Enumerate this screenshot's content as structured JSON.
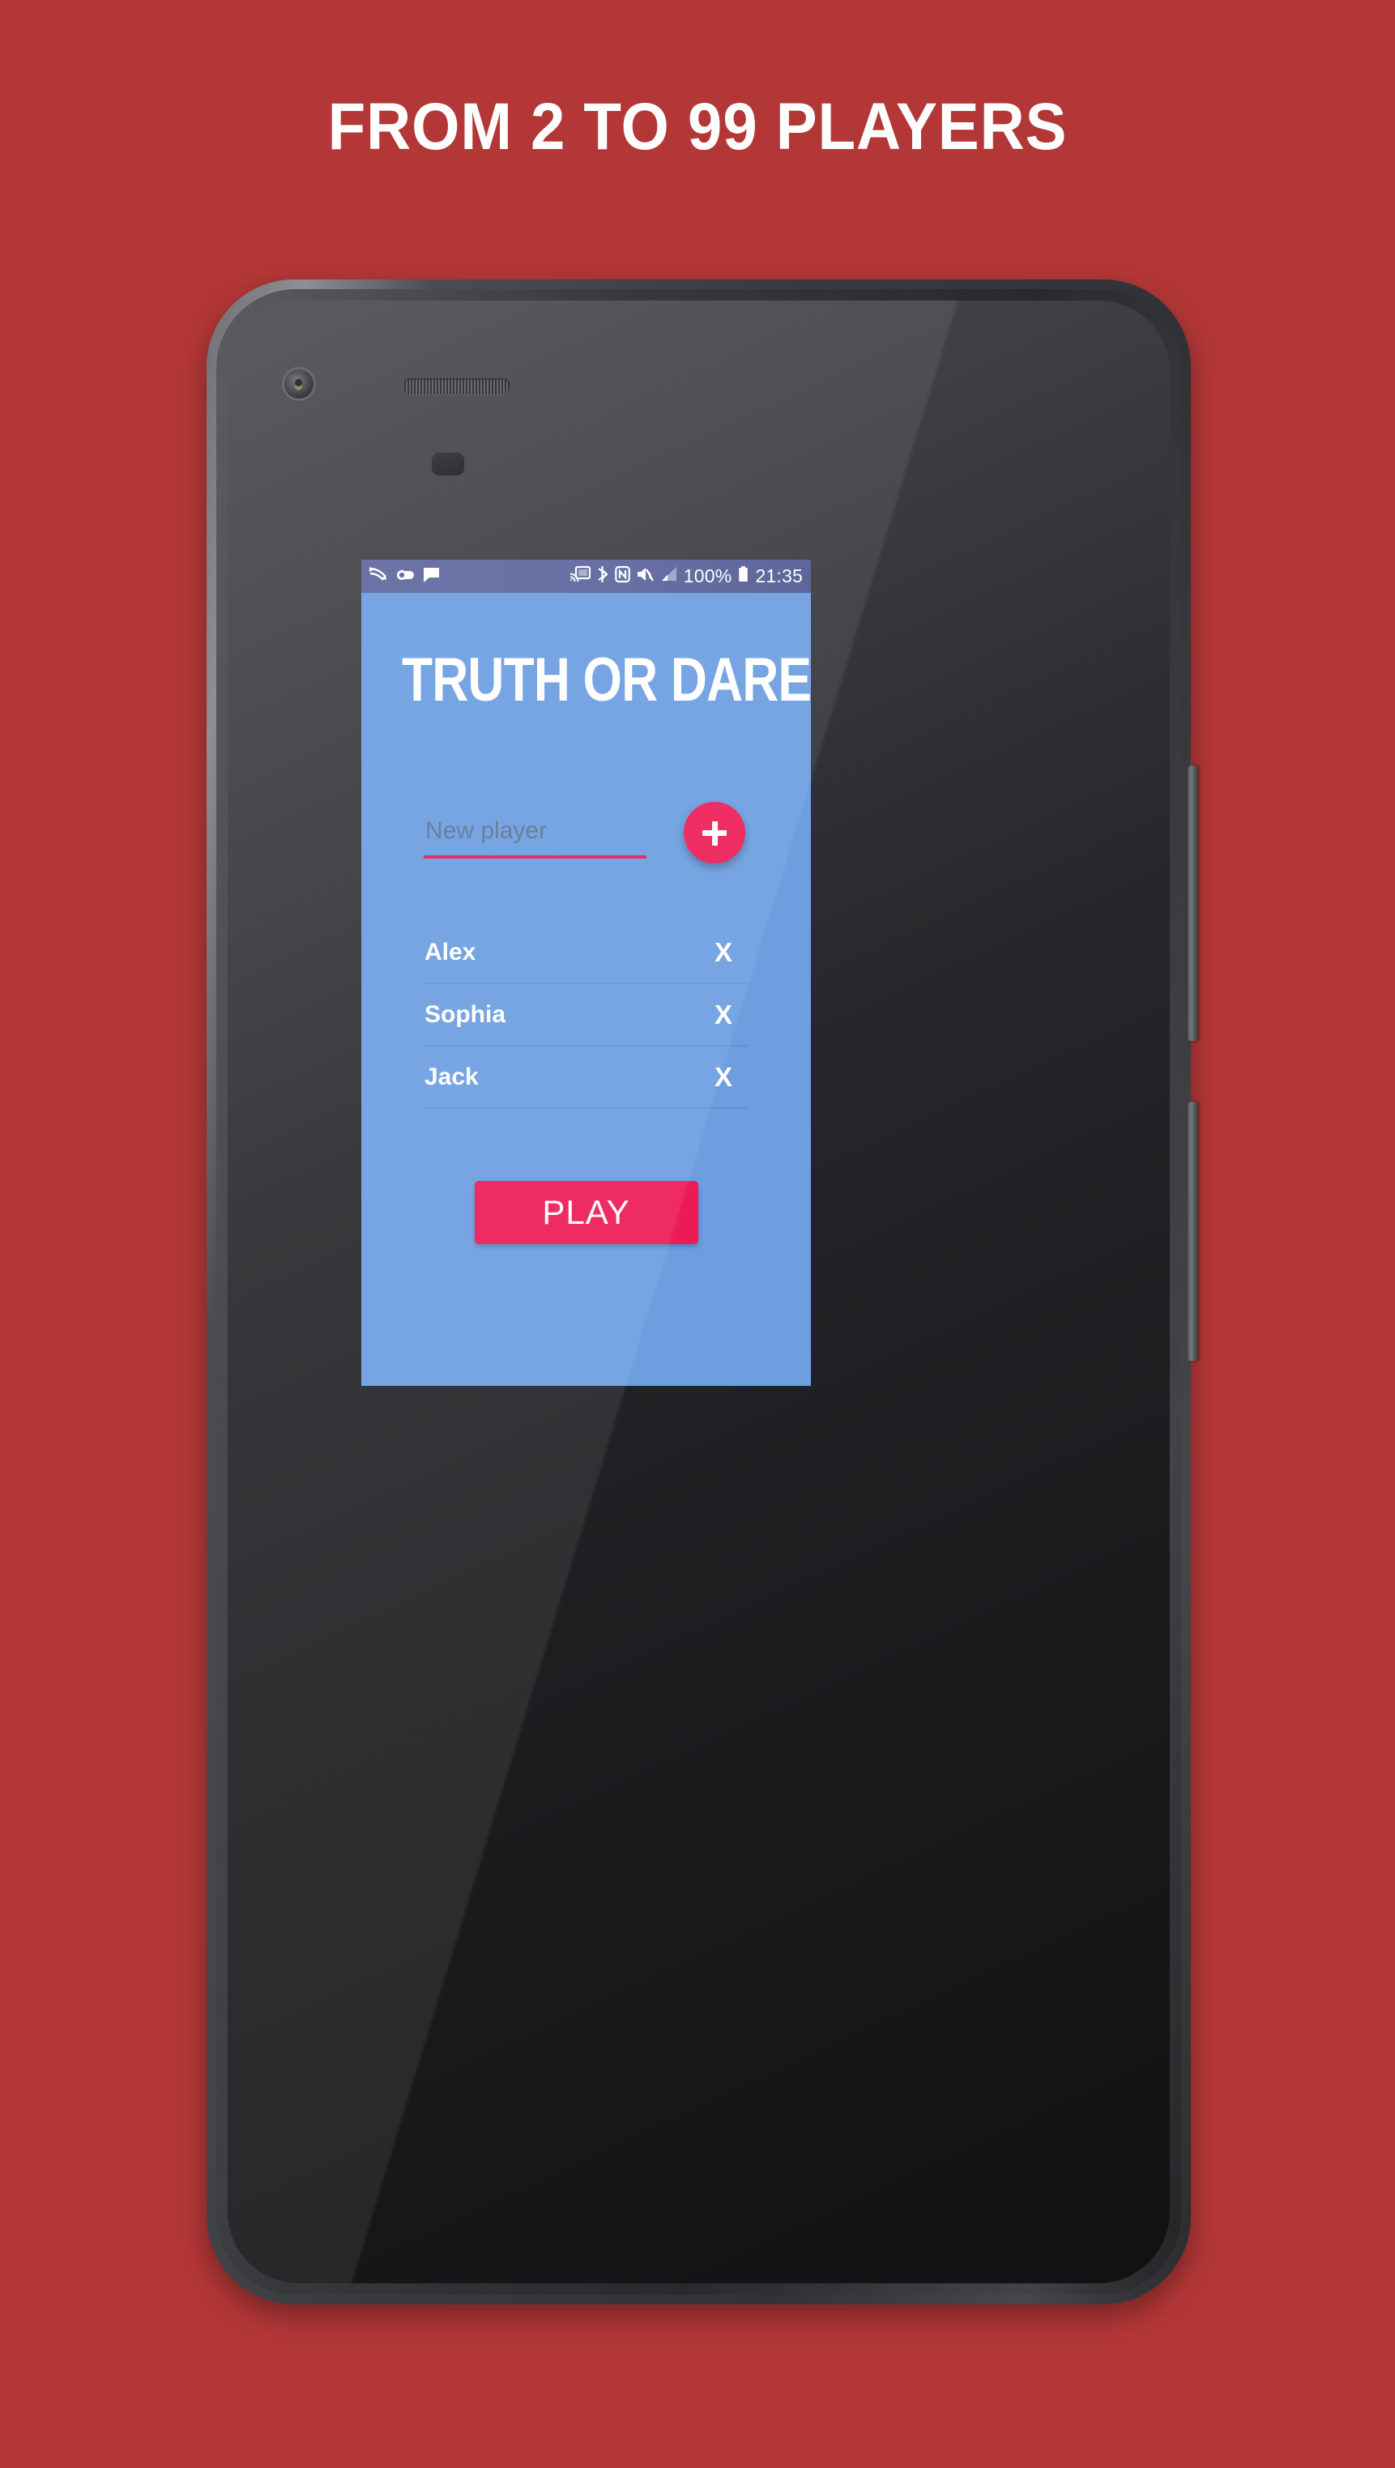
{
  "promo": {
    "headline": "FROM 2 TO 99 PLAYERS",
    "background_color": "#b43737",
    "text_color": "#ffffff"
  },
  "device": {
    "name": "android-phone-mockup",
    "body_color": "#35363a",
    "buttons": [
      {
        "name": "power-button",
        "label": "Power"
      },
      {
        "name": "volume-button",
        "label": "Volume"
      }
    ],
    "hardware": {
      "front_camera": "front-camera",
      "earpiece": "earpiece-speaker",
      "proximity_sensor": "proximity-sensor"
    }
  },
  "status_bar": {
    "background_color": "#5a639c",
    "left_icons": [
      {
        "name": "swipe-input-icon",
        "label": "Swipe input"
      },
      {
        "name": "cloud-sync-icon",
        "label": "Cloud sync"
      },
      {
        "name": "message-bubble-icon",
        "label": "Message"
      }
    ],
    "right_icons": [
      {
        "name": "cast-icon",
        "label": "Cast"
      },
      {
        "name": "bluetooth-icon",
        "label": "Bluetooth"
      },
      {
        "name": "nfc-icon",
        "label": "NFC"
      },
      {
        "name": "volume-mute-icon",
        "label": "Muted"
      },
      {
        "name": "signal-icon",
        "label": "Signal"
      }
    ],
    "battery_percent": "100%",
    "battery_icon": "battery-full-icon",
    "clock": "21:35"
  },
  "app": {
    "title": "TRUTH OR DARE",
    "background_color": "#6a9de0",
    "accent_color": "#ec1854",
    "add_player": {
      "input_value": "",
      "input_placeholder": "New player",
      "add_button_icon": "plus-icon",
      "add_button_label": "+"
    },
    "players": [
      {
        "name": "Alex",
        "remove_label": "X"
      },
      {
        "name": "Sophia",
        "remove_label": "X"
      },
      {
        "name": "Jack",
        "remove_label": "X"
      }
    ],
    "play_button_label": "PLAY"
  }
}
